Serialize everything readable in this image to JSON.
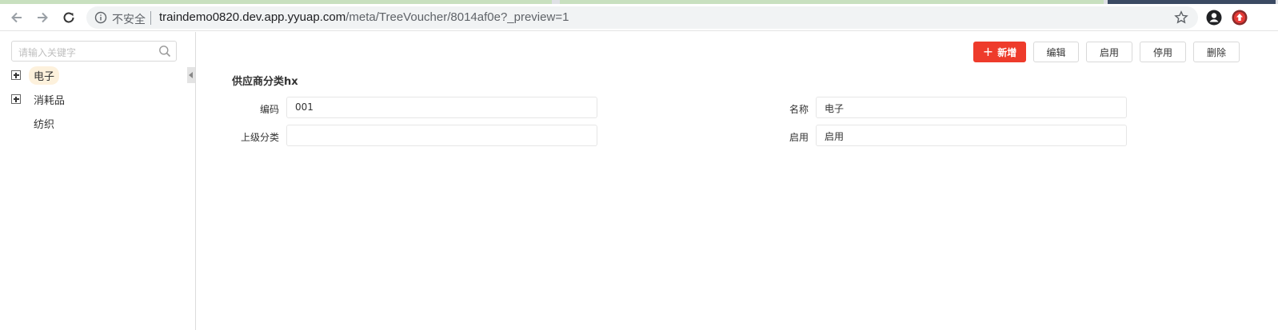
{
  "browser": {
    "omnibox": {
      "security_label": "不安全",
      "url_host": "traindemo0820.dev.app.yyuap.com",
      "url_path": "/meta/TreeVoucher/8014af0e?_preview=1"
    }
  },
  "sidebar": {
    "search_placeholder": "请输入关键字",
    "tree": [
      {
        "label": "电子",
        "expandable": true,
        "selected": true
      },
      {
        "label": "消耗品",
        "expandable": true,
        "selected": false
      },
      {
        "label": "纺织",
        "expandable": false,
        "selected": false
      }
    ]
  },
  "toolbar": {
    "add_label": "新增",
    "edit_label": "编辑",
    "enable_label": "启用",
    "disable_label": "停用",
    "delete_label": "删除"
  },
  "form": {
    "title": "供应商分类hx",
    "code": {
      "label": "编码",
      "value": "001"
    },
    "name": {
      "label": "名称",
      "value": "电子"
    },
    "parent": {
      "label": "上级分类",
      "value": ""
    },
    "status": {
      "label": "启用",
      "value": "启用"
    }
  },
  "colors": {
    "primary": "#ee3b2b",
    "selected_bg": "#fdf1dc"
  }
}
